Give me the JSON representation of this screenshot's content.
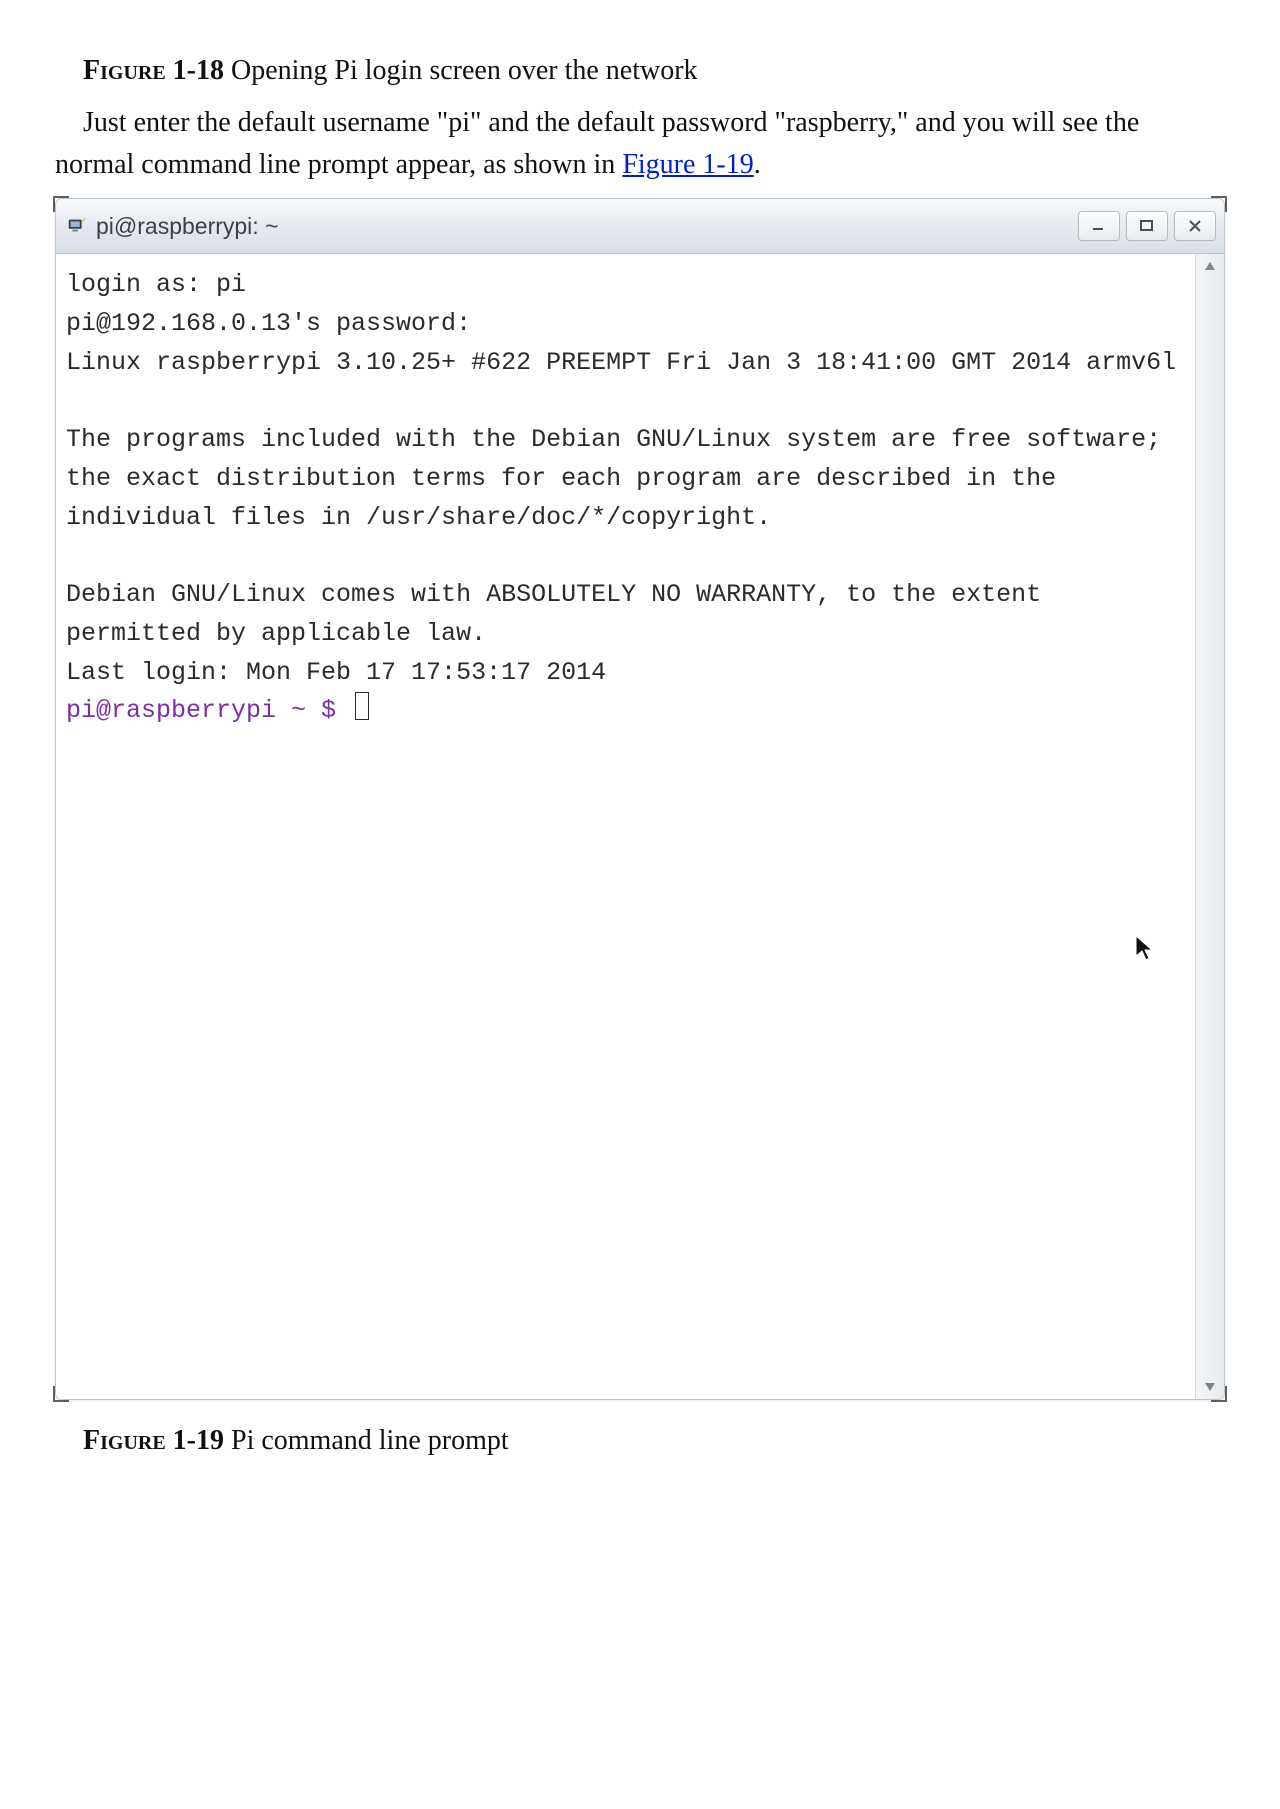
{
  "caption_top": {
    "label": "Figure 1-18",
    "text": " Opening Pi login screen over the network"
  },
  "paragraph": {
    "lead": "Just enter the default username \"pi\" and the default password \"raspberry,\" and you will see the normal command line prompt appear, as shown in ",
    "link_text": "Figure 1-19",
    "tail": "."
  },
  "window": {
    "title": "pi@raspberrypi: ~"
  },
  "terminal": {
    "lines": [
      "login as: pi",
      "pi@192.168.0.13's password:",
      "Linux raspberrypi 3.10.25+ #622 PREEMPT Fri Jan 3 18:41:00 GMT 2014 armv6l",
      "",
      "The programs included with the Debian GNU/Linux system are free software;",
      "the exact distribution terms for each program are described in the",
      "individual files in /usr/share/doc/*/copyright.",
      "",
      "Debian GNU/Linux comes with ABSOLUTELY NO WARRANTY, to the extent",
      "permitted by applicable law.",
      "Last login: Mon Feb 17 17:53:17 2014"
    ],
    "prompt": "pi@raspberrypi ~ $"
  },
  "caption_bottom": {
    "label": "Figure 1-19",
    "text": " Pi command line prompt"
  }
}
